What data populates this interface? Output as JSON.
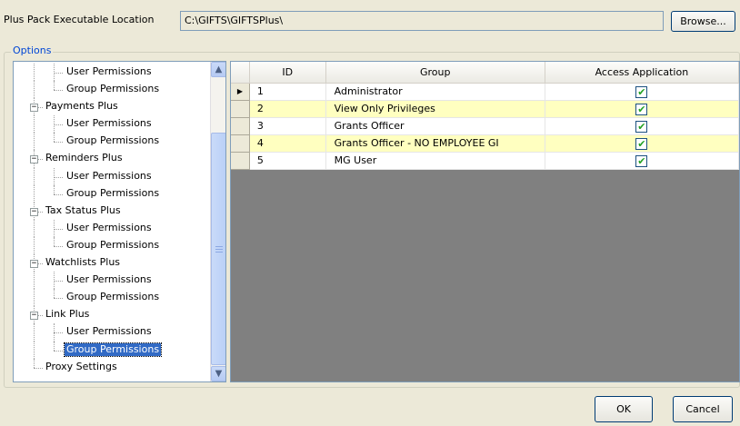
{
  "location": {
    "label": "Plus Pack Executable Location",
    "value": "C:\\GIFTS\\GIFTSPlus\\",
    "browse_label": "Browse..."
  },
  "options": {
    "legend": "Options",
    "tree": [
      {
        "label": "User Permissions",
        "level": 1
      },
      {
        "label": "Group Permissions",
        "level": 1
      },
      {
        "label": "Payments Plus",
        "level": 0,
        "expander": "−"
      },
      {
        "label": "User Permissions",
        "level": 1
      },
      {
        "label": "Group Permissions",
        "level": 1
      },
      {
        "label": "Reminders Plus",
        "level": 0,
        "expander": "−"
      },
      {
        "label": "User Permissions",
        "level": 1
      },
      {
        "label": "Group Permissions",
        "level": 1
      },
      {
        "label": "Tax Status Plus",
        "level": 0,
        "expander": "−"
      },
      {
        "label": "User Permissions",
        "level": 1
      },
      {
        "label": "Group Permissions",
        "level": 1
      },
      {
        "label": "Watchlists Plus",
        "level": 0,
        "expander": "−"
      },
      {
        "label": "User Permissions",
        "level": 1
      },
      {
        "label": "Group Permissions",
        "level": 1
      },
      {
        "label": "Link Plus",
        "level": 0,
        "expander": "−"
      },
      {
        "label": "User Permissions",
        "level": 1
      },
      {
        "label": "Group Permissions",
        "level": 1,
        "selected": true
      },
      {
        "label": "Proxy Settings",
        "level": 0
      }
    ],
    "scroll_up_icon": "▲",
    "scroll_down_icon": "▼"
  },
  "grid": {
    "columns": {
      "id": "ID",
      "group": "Group",
      "access": "Access Application"
    },
    "current_row_icon": "▶",
    "rows": [
      {
        "id": "1",
        "group": "Administrator",
        "access": true,
        "current": true
      },
      {
        "id": "2",
        "group": "View Only Privileges",
        "access": true
      },
      {
        "id": "3",
        "group": "Grants Officer",
        "access": true
      },
      {
        "id": "4",
        "group": "Grants Officer - NO EMPLOYEE GI",
        "access": true
      },
      {
        "id": "5",
        "group": "MG User",
        "access": true
      }
    ],
    "check_mark": "✔"
  },
  "footer": {
    "ok_label": "OK",
    "cancel_label": "Cancel"
  }
}
